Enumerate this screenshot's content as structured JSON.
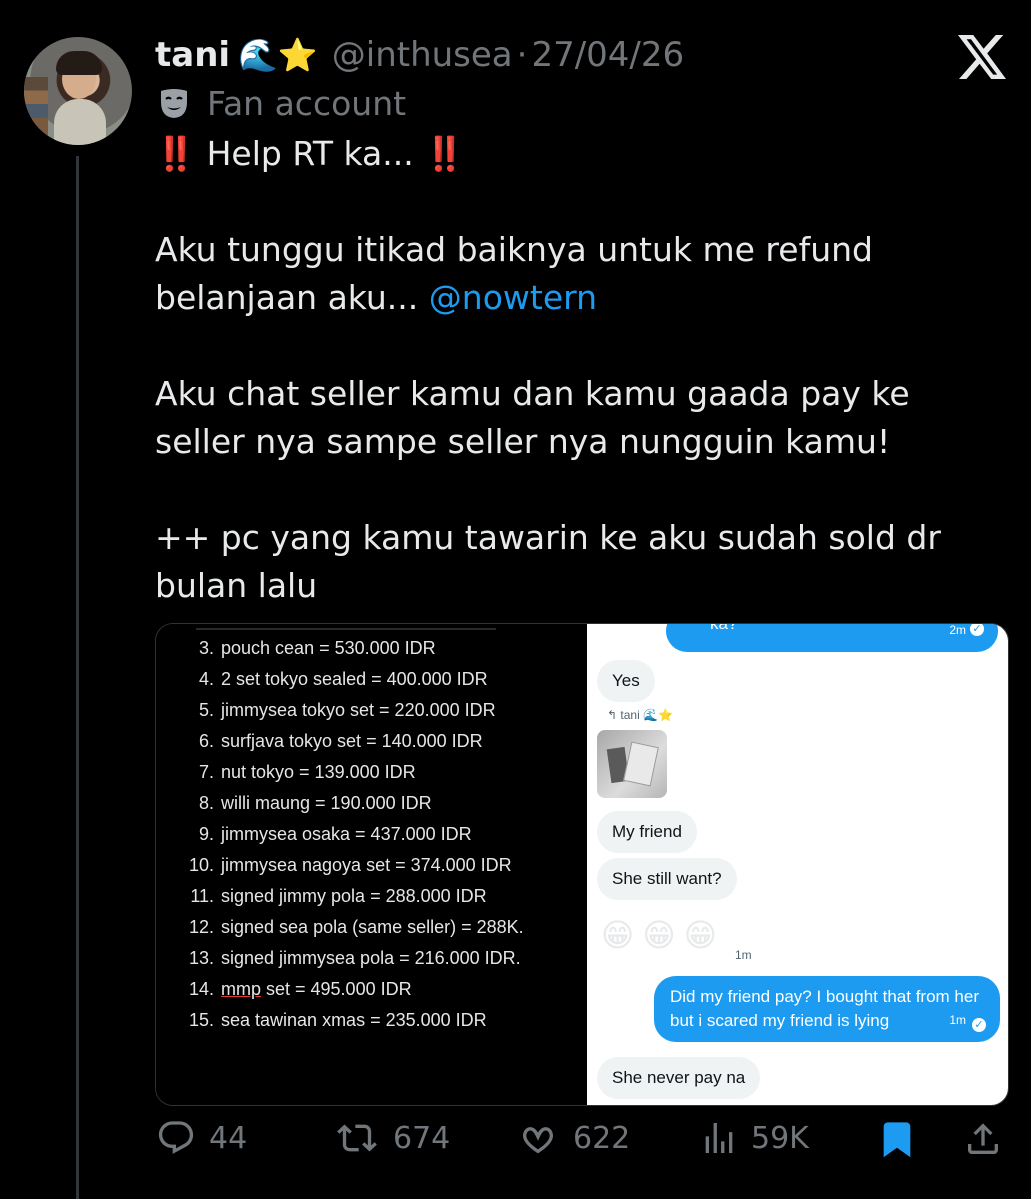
{
  "author": {
    "name": "tani",
    "name_emoji": "🌊⭐",
    "handle": "@inthusea",
    "separator": "·",
    "date": "27/04/26",
    "label_icon": "theater-mask-icon",
    "label": "Fan account"
  },
  "post": {
    "line1_prefix": "‼️",
    "line1_text": "Help RT ka...",
    "line1_suffix": "‼️",
    "p2_text": "Aku tunggu itikad baiknya untuk me refund belanjaan aku...",
    "p2_mention": "@nowtern",
    "p3": "Aku chat seller kamu dan kamu gaada pay ke seller nya sampe seller nya nungguin kamu!",
    "p4": "++ pc yang kamu tawarin ke aku sudah sold dr bulan lalu"
  },
  "media": {
    "list": [
      {
        "num": "3.",
        "text": "pouch cean = 530.000 IDR"
      },
      {
        "num": "4.",
        "text": "2 set tokyo sealed = 400.000 IDR"
      },
      {
        "num": "5.",
        "text": "jimmysea tokyo set = 220.000 IDR"
      },
      {
        "num": "6.",
        "text": "surfjava tokyo set = 140.000 IDR"
      },
      {
        "num": "7.",
        "text": "nut tokyo = 139.000 IDR"
      },
      {
        "num": "8.",
        "text": "willi maung = 190.000 IDR"
      },
      {
        "num": "9.",
        "text": "jimmysea osaka = 437.000 IDR"
      },
      {
        "num": "10.",
        "text": "jimmysea nagoya set = 374.000 IDR"
      },
      {
        "num": "11.",
        "text": "signed jimmy pola = 288.000 IDR"
      },
      {
        "num": "12.",
        "text": "signed sea pola (same seller) = 288K."
      },
      {
        "num": "13.",
        "text": "signed jimmysea pola = 216.000 IDR."
      },
      {
        "num": "14.",
        "text_underlined": "mmp",
        "text": " set = 495.000 IDR"
      },
      {
        "num": "15.",
        "text": "sea tawinan xmas = 235.000 IDR"
      }
    ],
    "chat": {
      "top_partial": "ka?",
      "top_time": "2m",
      "yes": "Yes",
      "reply_to": "↰ tani 🌊⭐",
      "my_friend": "My friend",
      "still_want": "She still want?",
      "emojis": "😁😁😁",
      "emoji_time": "1m",
      "question": "Did my friend pay? I bought that from her but i scared my friend is lying",
      "question_time": "1m",
      "never_pay": "She never pay na"
    }
  },
  "actions": {
    "replies": "44",
    "reposts": "674",
    "likes": "622",
    "views": "59K"
  },
  "colors": {
    "background": "#000000",
    "accent": "#1d9bf0",
    "muted": "#71767b",
    "text": "#e7e9ea"
  }
}
